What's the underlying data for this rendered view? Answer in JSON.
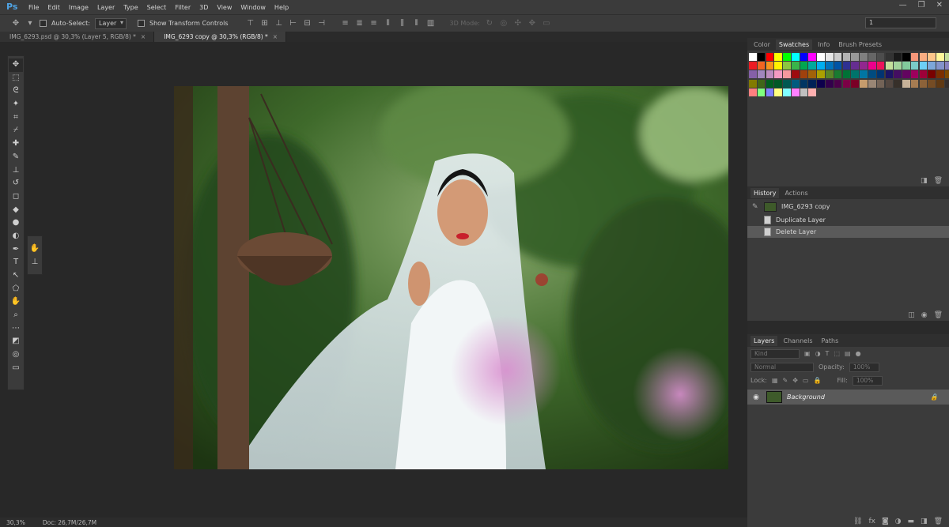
{
  "app": {
    "logo": "Ps",
    "menu": [
      "File",
      "Edit",
      "Image",
      "Layer",
      "Type",
      "Select",
      "Filter",
      "3D",
      "View",
      "Window",
      "Help"
    ],
    "window_controls": [
      "—",
      "❐",
      "✕"
    ]
  },
  "options_bar": {
    "auto_select_label": "Auto-Select:",
    "auto_select_value": "Layer",
    "show_transform_label": "Show Transform Controls",
    "mode_label": "3D Mode:",
    "workspace_value": "1"
  },
  "doc_tabs": [
    {
      "label": "IMG_6293.psd @ 30,3% (Layer 5, RGB/8) *",
      "close": "×",
      "active": false
    },
    {
      "label": "IMG_6293 copy @ 30,3% (RGB/8) *",
      "close": "×",
      "active": true
    }
  ],
  "tools": [
    "move-icon",
    "marquee-icon",
    "lasso-icon",
    "magic-wand-icon",
    "crop-icon",
    "eyedropper-icon",
    "healing-brush-icon",
    "brush-icon",
    "clone-stamp-icon",
    "history-brush-icon",
    "eraser-icon",
    "paint-bucket-icon",
    "blur-icon",
    "dodge-icon",
    "pen-icon",
    "type-icon",
    "path-selection-icon",
    "shape-icon",
    "hand-icon",
    "zoom-icon",
    "more-tools-icon",
    "color-swatches-icon",
    "quick-mask-icon",
    "screen-mode-icon"
  ],
  "tool_glyphs": [
    "✥",
    "⬚",
    "ᘓ",
    "✦",
    "⌗",
    "⌿",
    "✚",
    "✎",
    "⊥",
    "↺",
    "◻",
    "◆",
    "●",
    "◐",
    "✒",
    "T",
    "↖",
    "⬠",
    "✋",
    "⌕",
    "⋯",
    "◩",
    "◎",
    "▭"
  ],
  "status": {
    "zoom": "30,3%",
    "doc": "Doc: 26,7M/26,7M"
  },
  "swatches_panel": {
    "tabs": [
      "Color",
      "Swatches",
      "Info",
      "Brush Presets"
    ],
    "active_tab": "Swatches",
    "colors": [
      "#ffffff",
      "#000000",
      "#ff0000",
      "#ffff00",
      "#00ff00",
      "#00ffff",
      "#0000ff",
      "#ff00ff",
      "#ffffff",
      "#e6e6e6",
      "#cccccc",
      "#b3b3b3",
      "#999999",
      "#808080",
      "#666666",
      "#4d4d4d",
      "#333333",
      "#1a1a1a",
      "#000000",
      "#f7977a",
      "#f9ad81",
      "#fdc68a",
      "#fff79a",
      "#c4df9b",
      "#ed1c24",
      "#f26522",
      "#f7941d",
      "#fff200",
      "#8dc63f",
      "#39b54a",
      "#00a651",
      "#00a99d",
      "#00aeef",
      "#0072bc",
      "#0054a6",
      "#2e3192",
      "#662d91",
      "#92278f",
      "#ec008c",
      "#ed145b",
      "#c4df9b",
      "#a3d39c",
      "#82ca9c",
      "#7accc8",
      "#6dcff6",
      "#7da7d9",
      "#8393ca",
      "#8781bd",
      "#8560a8",
      "#a186be",
      "#bd8cbf",
      "#f49ac2",
      "#f6989d",
      "#9e0b0f",
      "#a0410d",
      "#a36209",
      "#aba000",
      "#598527",
      "#1a7b30",
      "#007236",
      "#00746b",
      "#0076a3",
      "#004b80",
      "#003471",
      "#1b1464",
      "#440e62",
      "#630460",
      "#9e005d",
      "#9e0039",
      "#790000",
      "#7b2e00",
      "#7d4900",
      "#827b00",
      "#406618",
      "#005e20",
      "#005826",
      "#005952",
      "#005b7f",
      "#003663",
      "#002157",
      "#0d004c",
      "#32004b",
      "#4b0049",
      "#7b0046",
      "#7a0026",
      "#c69c6d",
      "#998675",
      "#736357",
      "#534741",
      "#37302a",
      "#c7b299",
      "#a67c52",
      "#8c6239",
      "#754c24",
      "#603913",
      "#362f2d",
      "#ff8080",
      "#80ff80",
      "#8080ff",
      "#ffff80",
      "#80ffff",
      "#ff80ff",
      "#c0c0c0",
      "#ffb0b0"
    ]
  },
  "history_panel": {
    "tabs": [
      "History",
      "Actions"
    ],
    "active_tab": "History",
    "snapshot": "IMG_6293 copy",
    "items": [
      "Duplicate Layer",
      "Delete Layer"
    ]
  },
  "layers_panel": {
    "tabs": [
      "Layers",
      "Channels",
      "Paths"
    ],
    "active_tab": "Layers",
    "kind_placeholder": "Kind",
    "blend_mode": "Normal",
    "opacity_label": "Opacity:",
    "opacity_value": "100%",
    "lock_label": "Lock:",
    "fill_label": "Fill:",
    "fill_value": "100%",
    "layers": [
      {
        "name": "Background",
        "locked": true,
        "visible": true
      }
    ],
    "footer_icons": [
      "link-icon",
      "fx-icon",
      "mask-icon",
      "adjustment-icon",
      "group-icon",
      "new-layer-icon",
      "trash-icon"
    ],
    "footer_glyphs": [
      "⛓",
      "fx",
      "◙",
      "◑",
      "▬",
      "◨",
      "🗑"
    ]
  }
}
